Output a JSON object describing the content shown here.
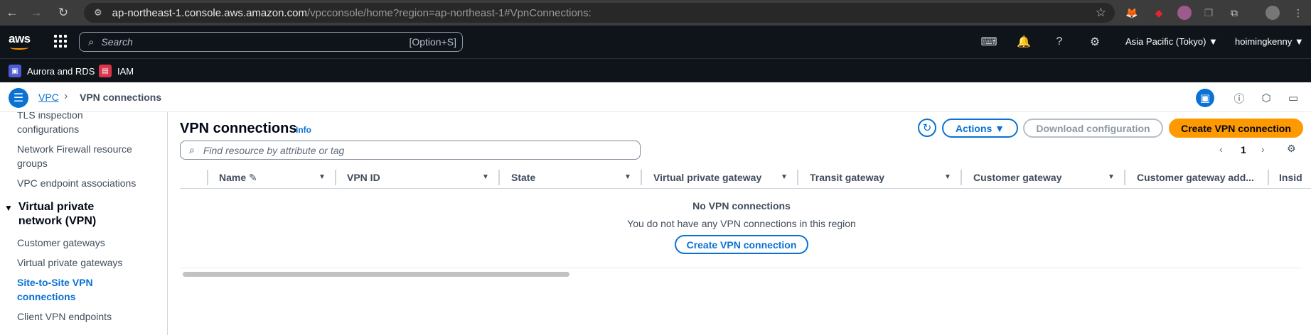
{
  "browser": {
    "url_host": "ap-northeast-1.console.aws.amazon.com",
    "url_path": "/vpcconsole/home?region=ap-northeast-1#VpnConnections:"
  },
  "aws_nav": {
    "logo_text": "aws",
    "search_placeholder": "Search",
    "search_shortcut": "[Option+S]",
    "region": "Asia Pacific (Tokyo) ▼",
    "user": "hoimingkenny ▼"
  },
  "favorites": [
    {
      "label": "Aurora and RDS",
      "color": "#4f5bd5"
    },
    {
      "label": "IAM",
      "color": "#dd344c"
    }
  ],
  "breadcrumb": {
    "service": "VPC",
    "current": "VPN connections"
  },
  "sidenav": {
    "items_top": [
      "TLS inspection configurations",
      "Network Firewall resource groups",
      "VPC endpoint associations"
    ],
    "section_title": "Virtual private network (VPN)",
    "section_items": [
      "Customer gateways",
      "Virtual private gateways",
      "Site-to-Site VPN connections",
      "Client VPN endpoints"
    ]
  },
  "main": {
    "title": "VPN connections",
    "info": "Info",
    "actions_label": "Actions ▼",
    "download_label": "Download configuration",
    "create_label": "Create VPN connection",
    "filter_placeholder": "Find resource by attribute or tag",
    "page_number": "1",
    "columns": [
      "Name",
      "VPN ID",
      "State",
      "Virtual private gateway",
      "Transit gateway",
      "Customer gateway",
      "Customer gateway add...",
      "Insid"
    ],
    "empty_title": "No VPN connections",
    "empty_message": "You do not have any VPN connections in this region",
    "empty_button": "Create VPN connection"
  },
  "colors": {
    "aws_nav_bg": "#0f141a",
    "link_blue": "#0972d3",
    "primary_orange": "#ff9900"
  }
}
